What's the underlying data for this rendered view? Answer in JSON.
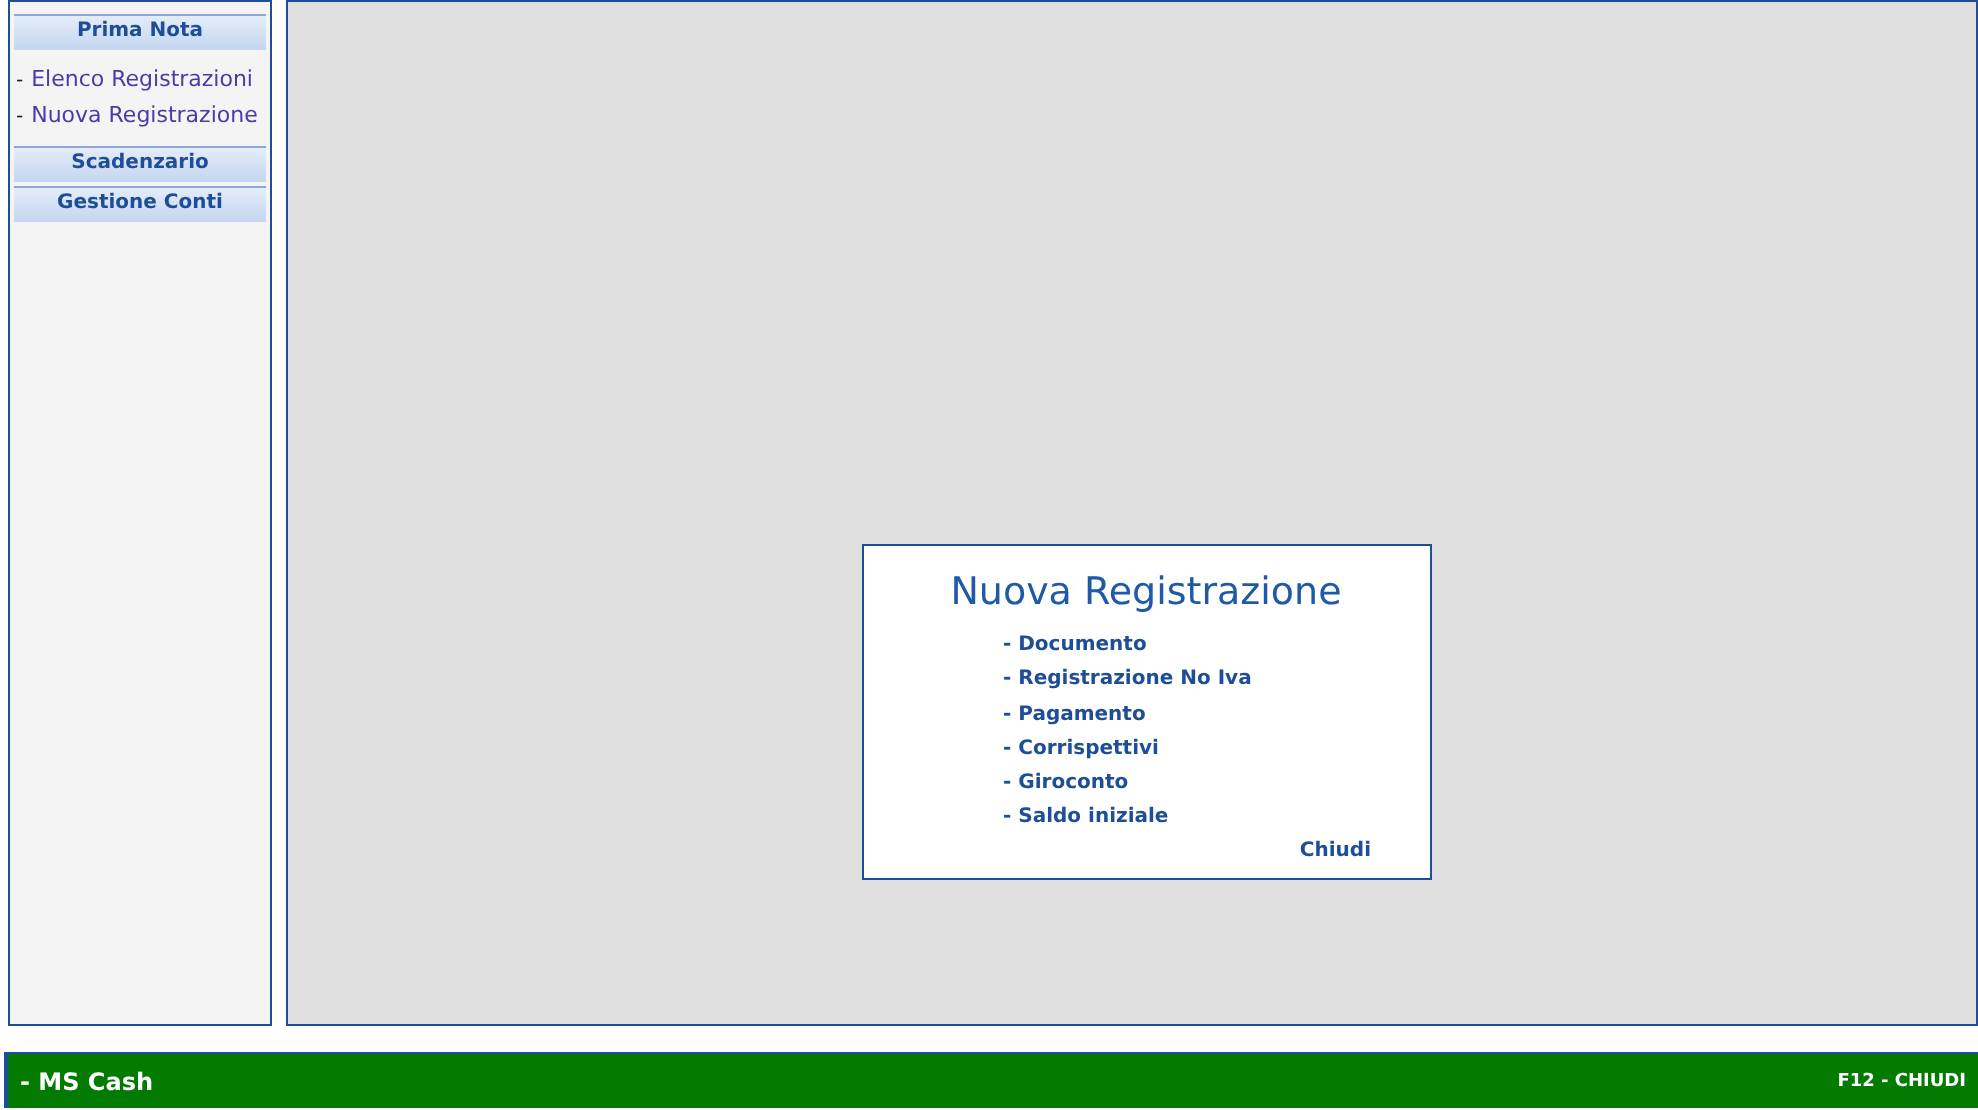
{
  "sidebar": {
    "sections": [
      {
        "title": "Prima Nota",
        "items": [
          {
            "bullet": "-",
            "label": "Elenco Registrazioni"
          },
          {
            "bullet": "-",
            "label": "Nuova Registrazione"
          }
        ]
      },
      {
        "title": "Scadenzario"
      },
      {
        "title": "Gestione Conti"
      }
    ]
  },
  "dialog": {
    "title": "Nuova Registrazione",
    "options": [
      "- Documento",
      "- Registrazione No Iva",
      "- Pagamento",
      "- Corrispettivi",
      "- Giroconto",
      "- Saldo iniziale"
    ],
    "close": "Chiudi"
  },
  "status_bar": {
    "app_name": "- MS Cash",
    "shortcut": "F12 - CHIUDI"
  }
}
